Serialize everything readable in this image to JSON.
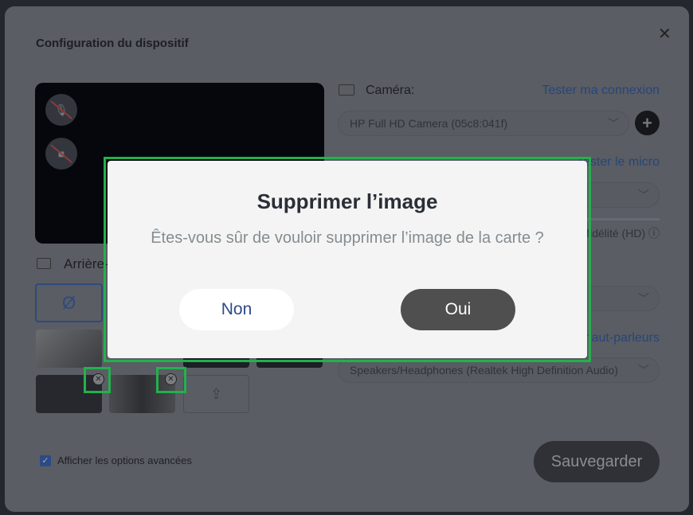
{
  "settings": {
    "title": "Configuration du dispositif",
    "background_label": "Arrière-plan",
    "none_symbol": "Ø",
    "camera_label": "Caméra:",
    "test_connection": "Tester ma connexion",
    "camera_value": "HP Full HD Camera (05c8:041f)",
    "test_mic": "Tester le micro",
    "hd_label": "Haute fidélité (HD)",
    "test_speakers": "Tester les haut-parleurs",
    "speakers_value": "Speakers/Headphones (Realtek High Definition Audio)",
    "advanced_options": "Afficher les options avancées",
    "save": "Sauvegarder"
  },
  "dialog": {
    "title": "Supprimer l’image",
    "message": "Êtes-vous sûr de vouloir supprimer l’image de la carte ?",
    "no": "Non",
    "yes": "Oui"
  },
  "colors": {
    "highlight": "#22b14c",
    "link": "#26467a",
    "yes_button": "#4f4f4f"
  }
}
